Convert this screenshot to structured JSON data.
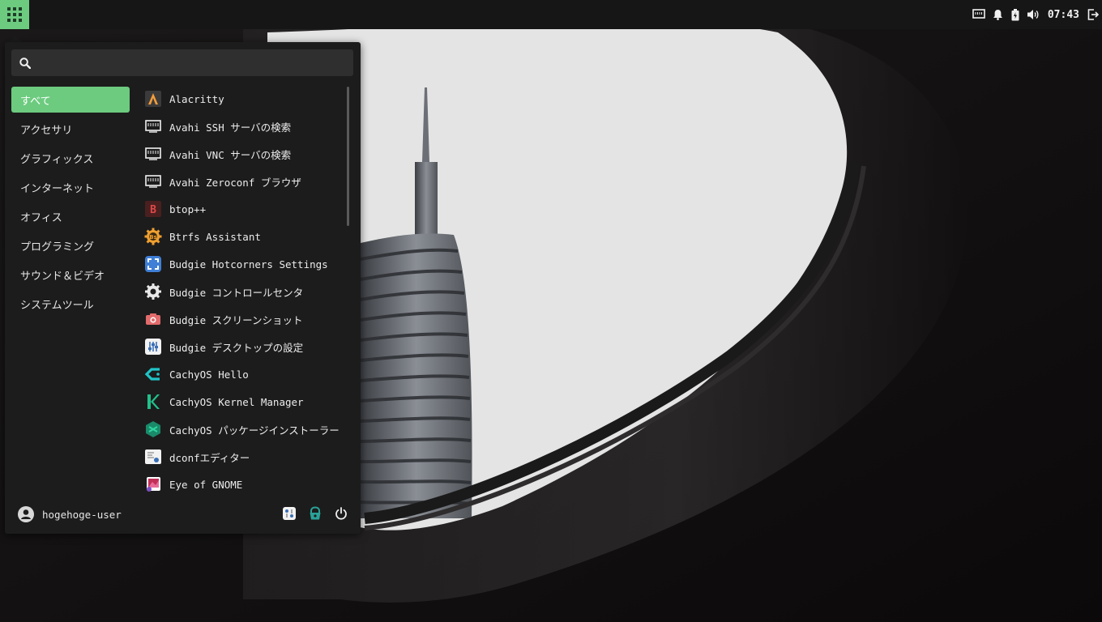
{
  "panel": {
    "clock": "07:43",
    "tray_icons": [
      "network-icon",
      "bell-icon",
      "battery-icon",
      "volume-icon",
      "logout-icon"
    ]
  },
  "menu": {
    "search": {
      "value": "",
      "placeholder": ""
    },
    "categories": [
      {
        "label": "すべて",
        "active": true
      },
      {
        "label": "アクセサリ"
      },
      {
        "label": "グラフィックス"
      },
      {
        "label": "インターネット"
      },
      {
        "label": "オフィス"
      },
      {
        "label": "プログラミング"
      },
      {
        "label": "サウンド＆ビデオ"
      },
      {
        "label": "システムツール"
      }
    ],
    "apps": [
      {
        "label": "Alacritty",
        "icon": "alacritty-icon"
      },
      {
        "label": "Avahi SSH サーバの検索",
        "icon": "network-server-icon"
      },
      {
        "label": "Avahi VNC サーバの検索",
        "icon": "network-server-icon"
      },
      {
        "label": "Avahi Zeroconf ブラウザ",
        "icon": "network-server-icon"
      },
      {
        "label": "btop++",
        "icon": "btop-icon"
      },
      {
        "label": "Btrfs Assistant",
        "icon": "btrfs-gear-icon"
      },
      {
        "label": "Budgie Hotcorners Settings",
        "icon": "hotcorners-icon"
      },
      {
        "label": "Budgie コントロールセンタ",
        "icon": "settings-gear-icon"
      },
      {
        "label": "Budgie スクリーンショット",
        "icon": "camera-icon"
      },
      {
        "label": "Budgie デスクトップの設定",
        "icon": "desktop-settings-icon"
      },
      {
        "label": "CachyOS Hello",
        "icon": "cachyos-hello-icon"
      },
      {
        "label": "CachyOS Kernel Manager",
        "icon": "kernel-manager-icon"
      },
      {
        "label": "CachyOS パッケージインストーラー",
        "icon": "package-installer-icon"
      },
      {
        "label": "dconfエディター",
        "icon": "dconf-editor-icon"
      },
      {
        "label": "Eye of GNOME",
        "icon": "image-viewer-icon"
      }
    ],
    "user": {
      "name": "hogehoge-user"
    },
    "actions": [
      "settings-icon",
      "lock-icon",
      "power-icon"
    ]
  },
  "colors": {
    "accent": "#6ccb7f",
    "panel": "#161616",
    "menu_bg": "#1c1c1c"
  }
}
